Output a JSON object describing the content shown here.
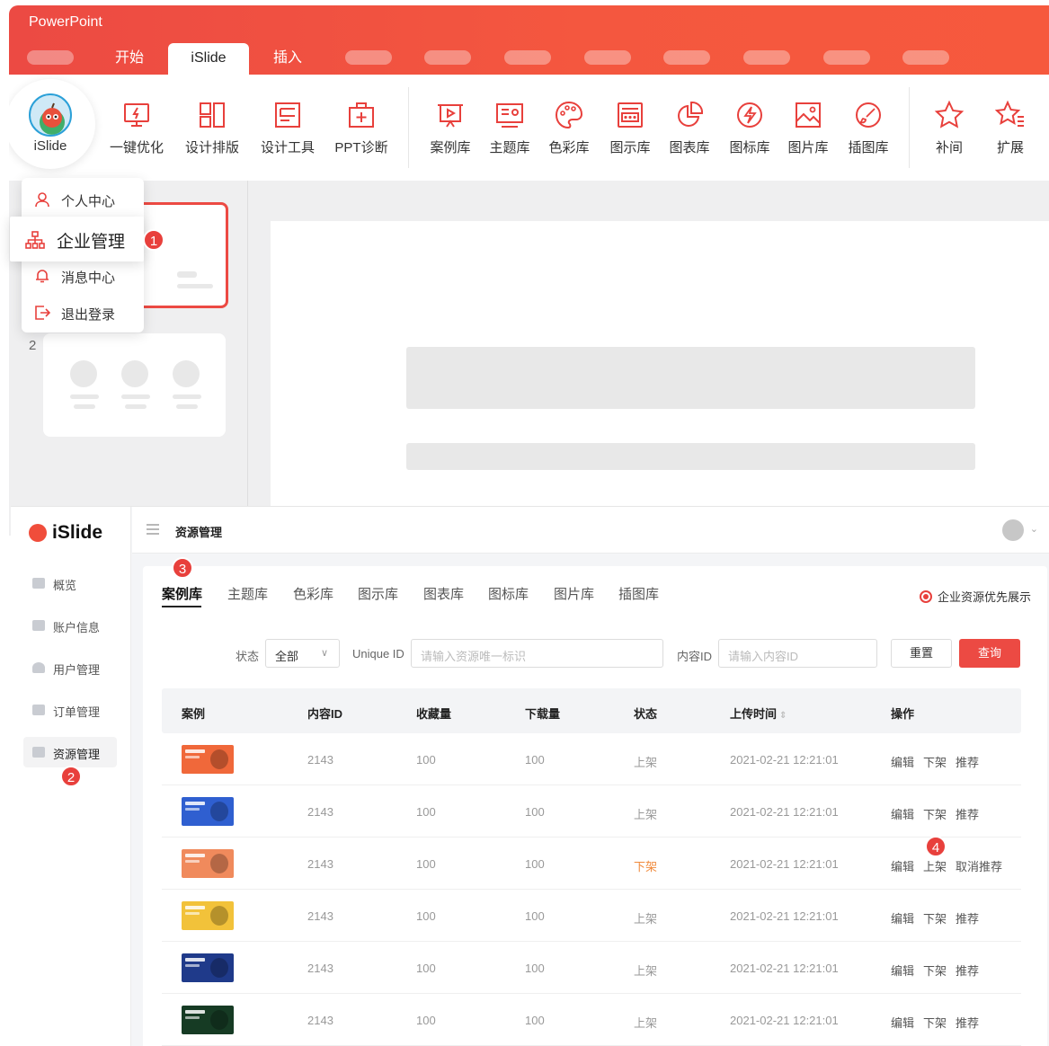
{
  "ppt": {
    "app_title": "PowerPoint",
    "tabs": [
      "开始",
      "iSlide",
      "插入"
    ],
    "active_tab": "iSlide",
    "avatar_name": "iSlide",
    "ribbon": [
      {
        "label": "一键优化",
        "icon": "monitor-lightning-icon"
      },
      {
        "label": "设计排版",
        "icon": "layout-grid-icon"
      },
      {
        "label": "设计工具",
        "icon": "design-tool-icon"
      },
      {
        "label": "PPT诊断",
        "icon": "medical-kit-icon"
      },
      {
        "label": "案例库",
        "icon": "presentation-icon"
      },
      {
        "label": "主题库",
        "icon": "theme-icon"
      },
      {
        "label": "色彩库",
        "icon": "palette-icon"
      },
      {
        "label": "图示库",
        "icon": "diagram-icon"
      },
      {
        "label": "图表库",
        "icon": "pie-chart-icon"
      },
      {
        "label": "图标库",
        "icon": "bolt-icon"
      },
      {
        "label": "图片库",
        "icon": "image-icon"
      },
      {
        "label": "插图库",
        "icon": "brush-icon"
      },
      {
        "label": "补间",
        "icon": "star-icon"
      },
      {
        "label": "扩展",
        "icon": "star-list-icon"
      }
    ],
    "user_menu": {
      "items": [
        "个人中心",
        "企业管理",
        "消息中心",
        "退出登录"
      ]
    },
    "slide_number_2": "2",
    "badge_1": "1"
  },
  "admin": {
    "logo": "iSlide",
    "nav": [
      "概览",
      "账户信息",
      "用户管理",
      "订单管理",
      "资源管理"
    ],
    "active_nav": "资源管理",
    "breadcrumb": "资源管理",
    "badge_2": "2",
    "badge_3": "3",
    "badge_4": "4",
    "resource_tabs": [
      "案例库",
      "主题库",
      "色彩库",
      "图示库",
      "图表库",
      "图标库",
      "图片库",
      "插图库"
    ],
    "active_resource_tab": "案例库",
    "priority_option": "企业资源优先展示",
    "filters": {
      "status_label": "状态",
      "status_value": "全部",
      "unique_id_label": "Unique ID",
      "unique_id_placeholder": "请输入资源唯一标识",
      "content_id_label": "内容ID",
      "content_id_placeholder": "请输入内容ID",
      "reset_label": "重置",
      "query_label": "查询"
    },
    "table": {
      "columns": [
        "案例",
        "内容ID",
        "收藏量",
        "下载量",
        "状态",
        "上传时间",
        "操作"
      ],
      "rows": [
        {
          "content_id": "2143",
          "favorites": "100",
          "downloads": "100",
          "status": "上架",
          "uploaded": "2021-02-21 12:21:01",
          "actions": [
            "编辑",
            "下架",
            "推荐"
          ],
          "thumb_color": "#f0683a"
        },
        {
          "content_id": "2143",
          "favorites": "100",
          "downloads": "100",
          "status": "上架",
          "uploaded": "2021-02-21 12:21:01",
          "actions": [
            "编辑",
            "下架",
            "推荐"
          ],
          "thumb_color": "#2f5fd0"
        },
        {
          "content_id": "2143",
          "favorites": "100",
          "downloads": "100",
          "status": "下架",
          "uploaded": "2021-02-21 12:21:01",
          "actions": [
            "编辑",
            "上架",
            "取消推荐"
          ],
          "thumb_color": "#f08a5c"
        },
        {
          "content_id": "2143",
          "favorites": "100",
          "downloads": "100",
          "status": "上架",
          "uploaded": "2021-02-21 12:21:01",
          "actions": [
            "编辑",
            "下架",
            "推荐"
          ],
          "thumb_color": "#f2c23a"
        },
        {
          "content_id": "2143",
          "favorites": "100",
          "downloads": "100",
          "status": "上架",
          "uploaded": "2021-02-21 12:21:01",
          "actions": [
            "编辑",
            "下架",
            "推荐"
          ],
          "thumb_color": "#1f3a8a"
        },
        {
          "content_id": "2143",
          "favorites": "100",
          "downloads": "100",
          "status": "上架",
          "uploaded": "2021-02-21 12:21:01",
          "actions": [
            "编辑",
            "下架",
            "推荐"
          ],
          "thumb_color": "#163b24"
        }
      ]
    }
  },
  "colors": {
    "accent": "#ec4a43",
    "status_off": "#f08a3c"
  }
}
